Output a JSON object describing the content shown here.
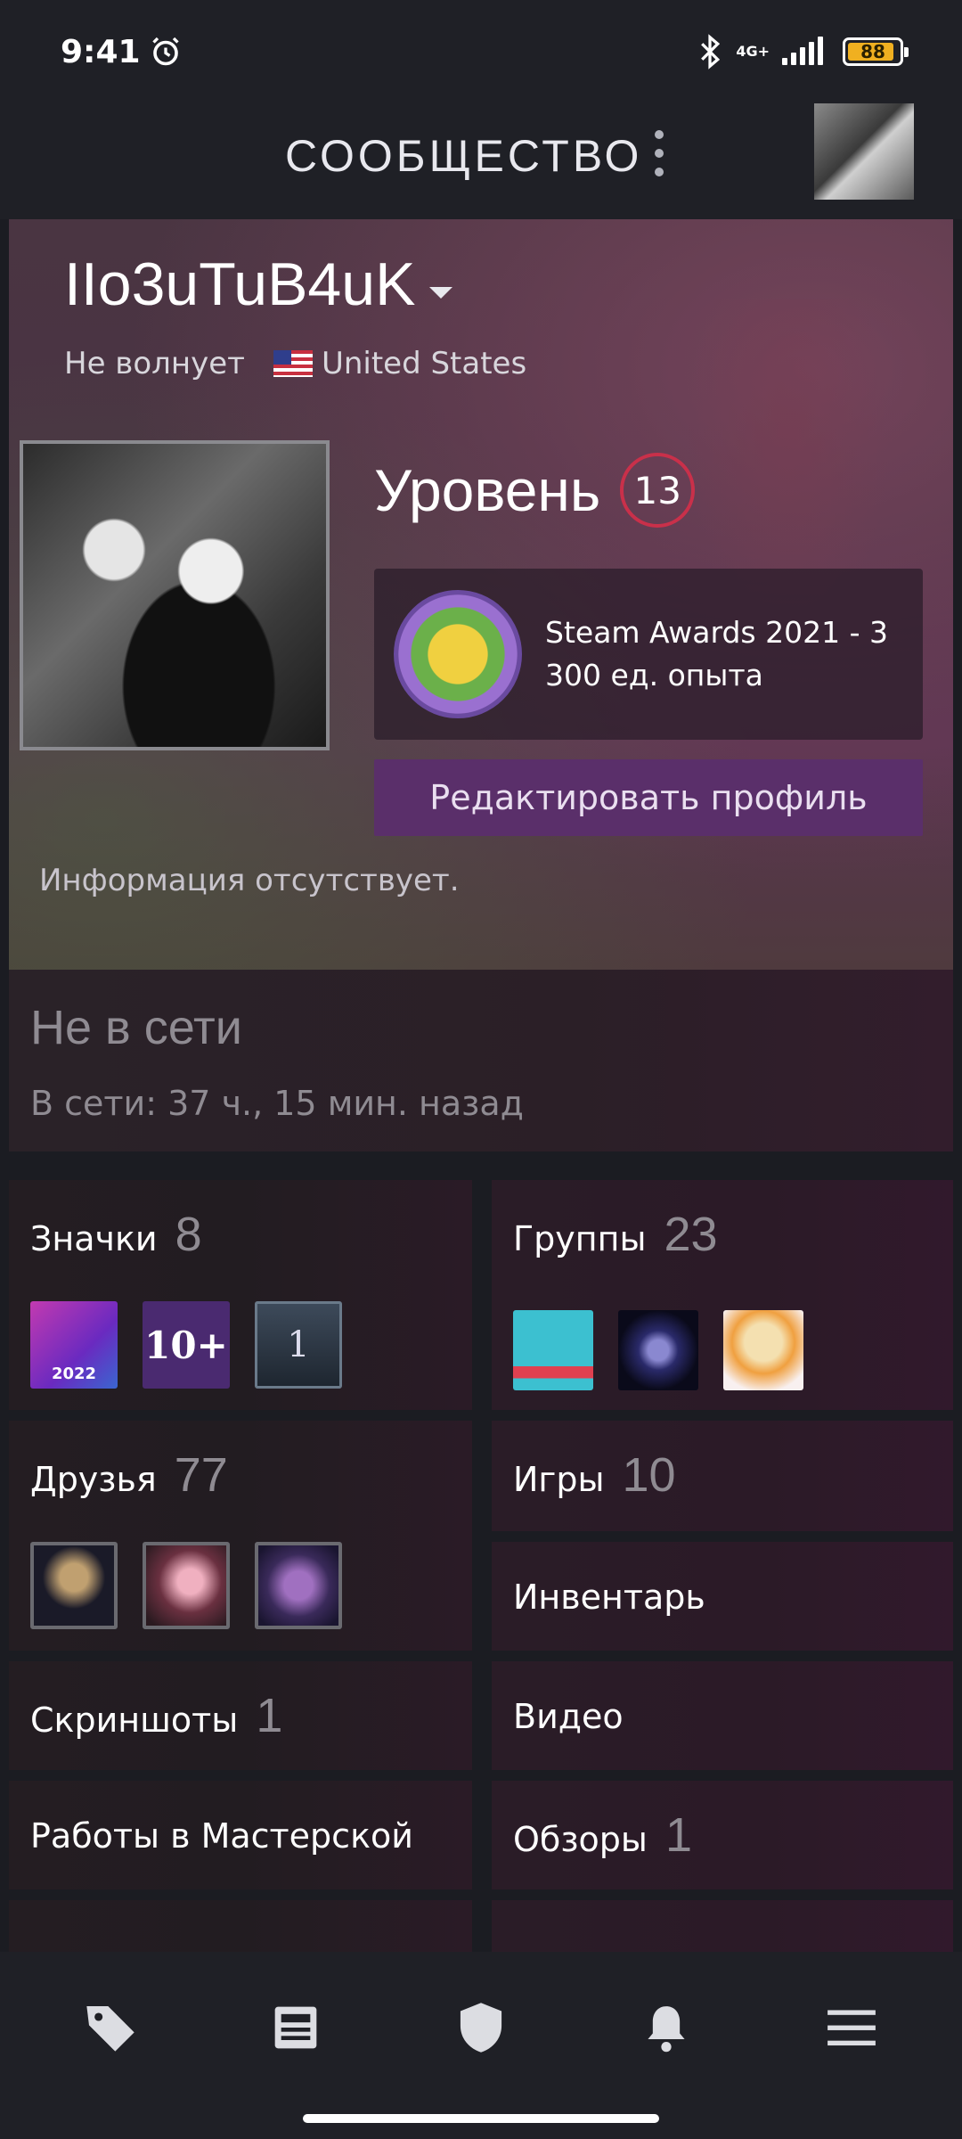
{
  "status_bar": {
    "time": "9:41",
    "network": "4G+",
    "battery": "88"
  },
  "header": {
    "title": "СООБЩЕСТВО"
  },
  "profile": {
    "persona_name": "IIo3uTuB4uK",
    "status": "Не волнует",
    "country": "United States",
    "level_label": "Уровень",
    "level": "13",
    "award_line1": "Steam Awards 2021 - 3",
    "award_line2": "300 ед. опыта",
    "edit_button": "Редактировать профиль",
    "summary": "Информация отсутствует."
  },
  "online_status": {
    "title": "Не в сети",
    "last_online": "В сети: 37 ч., 15 мин. назад"
  },
  "tiles": {
    "badges": {
      "label": "Значки",
      "count": "8",
      "thumb_texts": [
        "2022",
        "10+",
        "1"
      ]
    },
    "groups": {
      "label": "Группы",
      "count": "23"
    },
    "friends": {
      "label": "Друзья",
      "count": "77"
    },
    "games": {
      "label": "Игры",
      "count": "10"
    },
    "inventory": {
      "label": "Инвентарь"
    },
    "screenshots": {
      "label": "Скриншоты",
      "count": "1"
    },
    "videos": {
      "label": "Видео"
    },
    "workshop": {
      "label": "Работы в Мастерской"
    },
    "reviews": {
      "label": "Обзоры",
      "count": "1"
    }
  },
  "bottom_nav": {
    "icons": [
      "tag-icon",
      "news-icon",
      "shield-icon",
      "bell-icon",
      "menu-icon"
    ]
  },
  "colors": {
    "level_ring": "#c9304a",
    "edit_button_bg": "#5a2f6a",
    "battery": "#f0b020"
  }
}
